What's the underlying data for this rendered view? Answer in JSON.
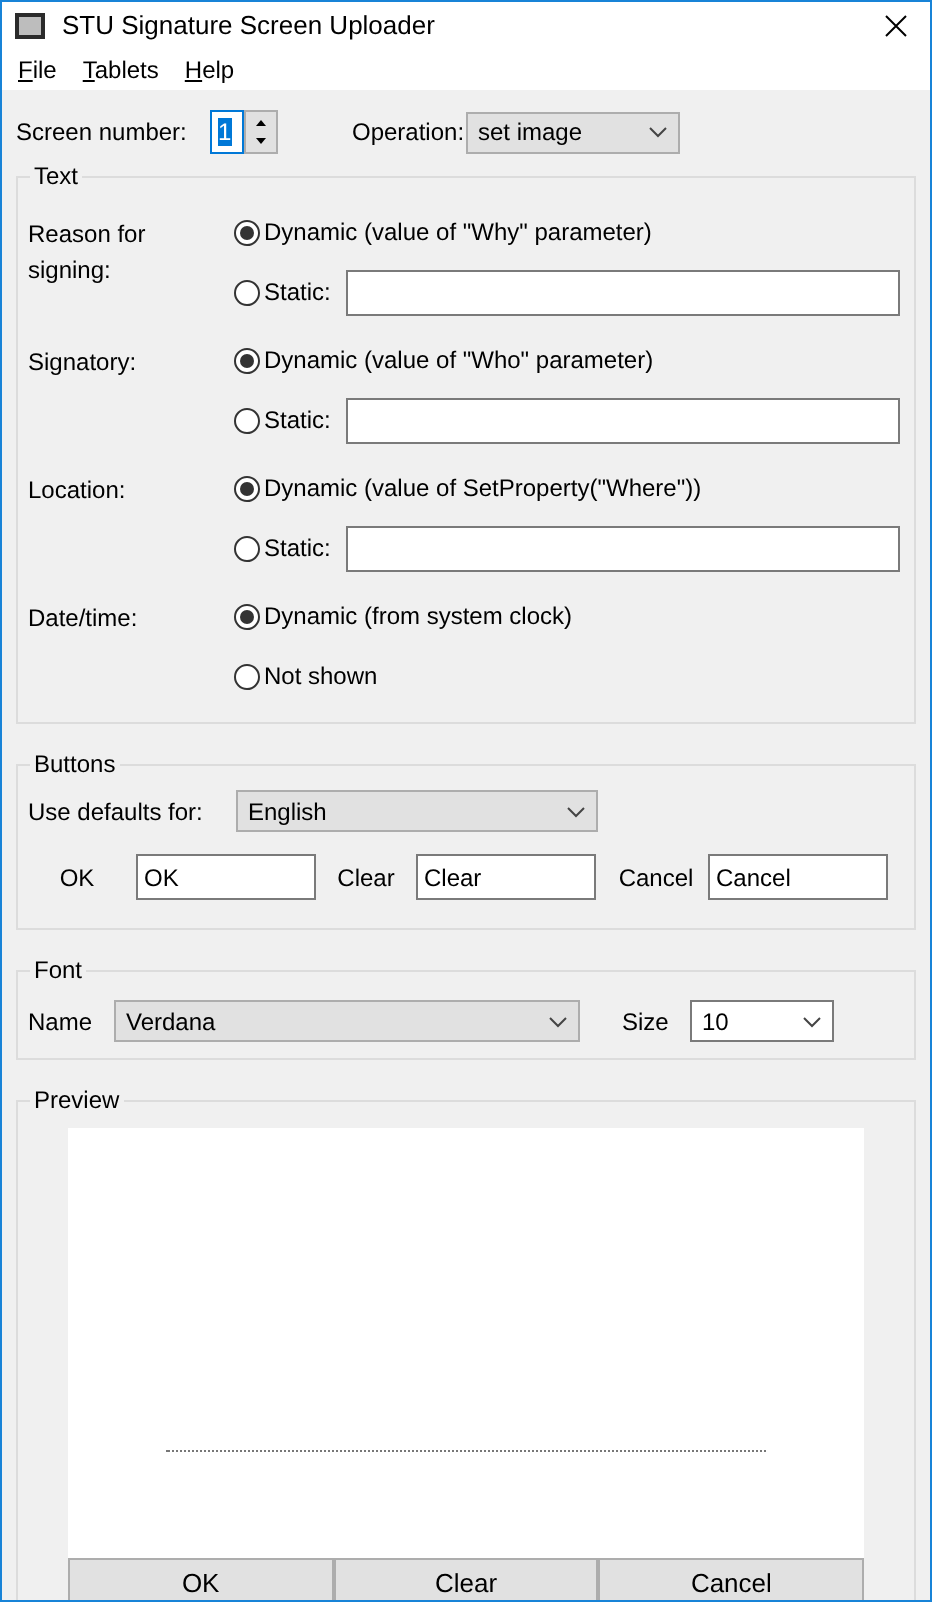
{
  "window": {
    "title": "STU Signature Screen Uploader"
  },
  "menu": [
    "File",
    "Tablets",
    "Help"
  ],
  "screen_number": {
    "label": "Screen number:",
    "value": "1"
  },
  "operation": {
    "label": "Operation:",
    "value": "set image"
  },
  "text_group": {
    "title": "Text",
    "fields": [
      {
        "label": "Reason for signing:",
        "options": [
          {
            "kind": "radio",
            "label": "Dynamic (value of \"Why\" parameter)",
            "selected": true
          },
          {
            "kind": "static",
            "label": "Static:",
            "selected": false
          }
        ]
      },
      {
        "label": "Signatory:",
        "options": [
          {
            "kind": "radio",
            "label": "Dynamic (value of \"Who\" parameter)",
            "selected": true
          },
          {
            "kind": "static",
            "label": "Static:",
            "selected": false
          }
        ]
      },
      {
        "label": "Location:",
        "options": [
          {
            "kind": "radio",
            "label": "Dynamic (value of SetProperty(\"Where\"))",
            "selected": true
          },
          {
            "kind": "static",
            "label": "Static:",
            "selected": false
          }
        ]
      },
      {
        "label": "Date/time:",
        "options": [
          {
            "kind": "radio",
            "label": "Dynamic (from system clock)",
            "selected": true
          },
          {
            "kind": "radio",
            "label": "Not shown",
            "selected": false
          }
        ]
      }
    ]
  },
  "buttons_group": {
    "title": "Buttons",
    "defaults_label": "Use defaults for:",
    "defaults_value": "English",
    "buttons": [
      {
        "label": "OK",
        "value": "OK"
      },
      {
        "label": "Clear",
        "value": "Clear"
      },
      {
        "label": "Cancel",
        "value": "Cancel"
      }
    ]
  },
  "font_group": {
    "title": "Font",
    "name_label": "Name",
    "name_value": "Verdana",
    "size_label": "Size",
    "size_value": "10"
  },
  "preview": {
    "title": "Preview",
    "buttons": [
      "OK",
      "Clear",
      "Cancel"
    ]
  }
}
